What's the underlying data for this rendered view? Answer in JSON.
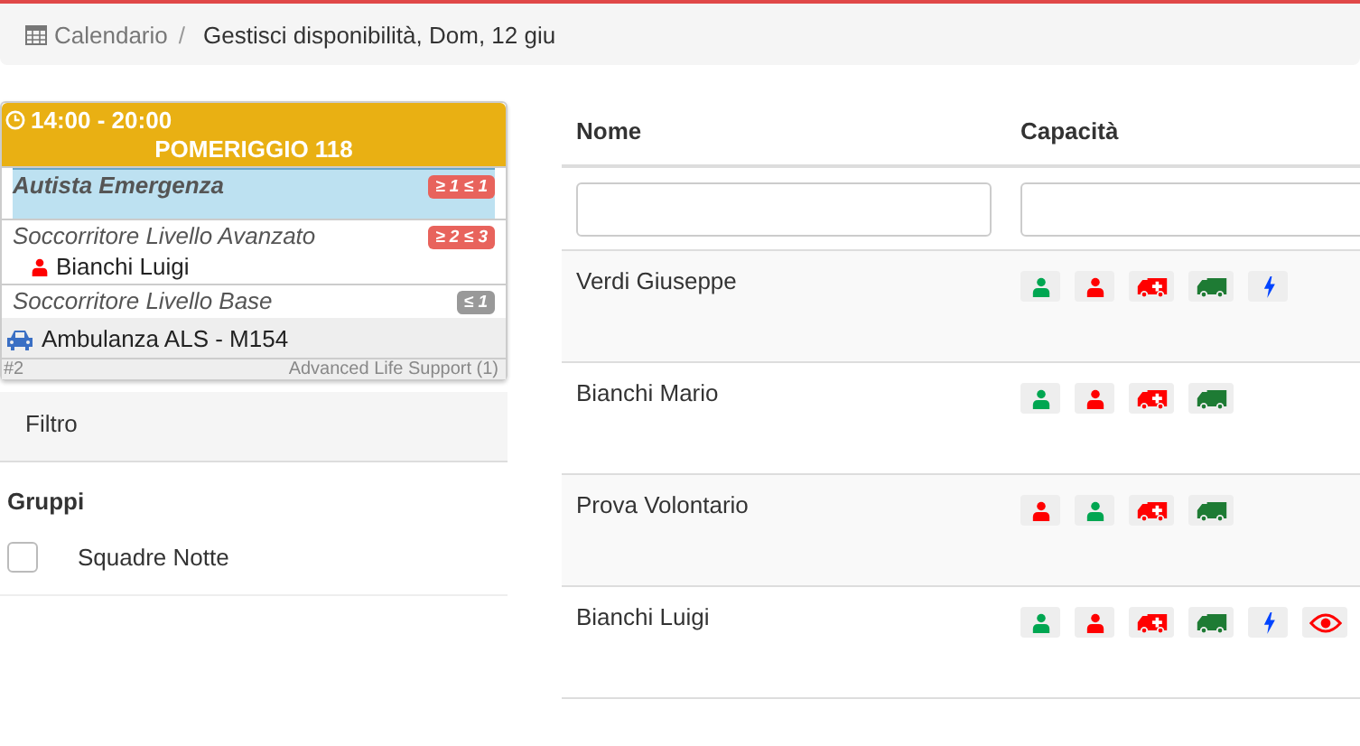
{
  "breadcrumb": {
    "items": [
      {
        "label": "Calendario",
        "kind": "link"
      },
      {
        "label": "Gestisci disponibilità, Dom, 12 giu",
        "kind": "current"
      }
    ],
    "separator": "/"
  },
  "shift": {
    "time": "14:00 - 20:00",
    "title": "POMERIGGIO 118",
    "roles": [
      {
        "name": "Autista Emergenza",
        "selected": true,
        "badge": "≥ 1 ≤ 1",
        "color": "#e8635c"
      },
      {
        "name": "Soccorritore Livello Avanzato",
        "selected": false,
        "badge": "≥ 2 ≤ 3",
        "color": "#e8635c",
        "people": [
          {
            "name": "Bianchi Luigi",
            "color": "#ff0000"
          }
        ]
      },
      {
        "name": "Soccorritore Livello Base",
        "selected": false,
        "badge": "≤ 1",
        "color": "#999999"
      }
    ],
    "vehicle": "Ambulanza ALS - M154",
    "number": "#2",
    "vehicle_type": "Advanced Life Support (1)"
  },
  "filter": {
    "title": "Filtro",
    "groups_title": "Gruppi",
    "groups": [
      {
        "label": "Squadre Notte",
        "checked": false
      }
    ]
  },
  "table": {
    "columns": [
      "Nome",
      "Capacità"
    ],
    "rows": [
      {
        "name": "Verdi Giuseppe",
        "caps": [
          {
            "kind": "person",
            "color": "#00a651"
          },
          {
            "kind": "person",
            "color": "#ff0000"
          },
          {
            "kind": "ambulance",
            "color": "#ff0000"
          },
          {
            "kind": "truck",
            "color": "#1e7b34"
          },
          {
            "kind": "bolt",
            "color": "#0044ff"
          }
        ]
      },
      {
        "name": "Bianchi Mario",
        "caps": [
          {
            "kind": "person",
            "color": "#00a651"
          },
          {
            "kind": "person",
            "color": "#ff0000"
          },
          {
            "kind": "ambulance",
            "color": "#ff0000"
          },
          {
            "kind": "truck",
            "color": "#1e7b34"
          }
        ]
      },
      {
        "name": "Prova Volontario",
        "caps": [
          {
            "kind": "person",
            "color": "#ff0000"
          },
          {
            "kind": "person",
            "color": "#00a651"
          },
          {
            "kind": "ambulance",
            "color": "#ff0000"
          },
          {
            "kind": "truck",
            "color": "#1e7b34"
          }
        ]
      },
      {
        "name": "Bianchi Luigi",
        "caps": [
          {
            "kind": "person",
            "color": "#00a651"
          },
          {
            "kind": "person",
            "color": "#ff0000"
          },
          {
            "kind": "ambulance",
            "color": "#ff0000"
          },
          {
            "kind": "truck",
            "color": "#1e7b34"
          },
          {
            "kind": "bolt",
            "color": "#0044ff"
          },
          {
            "kind": "eye",
            "color": "#ff0000"
          }
        ]
      }
    ]
  }
}
